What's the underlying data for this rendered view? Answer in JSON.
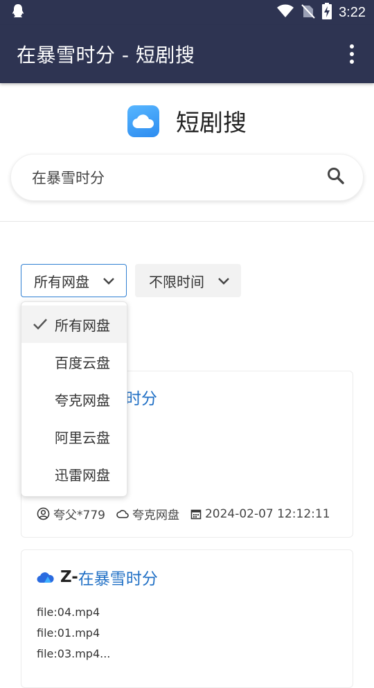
{
  "status_bar": {
    "time": "3:22"
  },
  "app_bar": {
    "title": "在暴雪时分 - 短剧搜"
  },
  "brand": {
    "name": "短剧搜"
  },
  "search": {
    "value": "在暴雪时分"
  },
  "filters": {
    "disk": {
      "label": "所有网盘"
    },
    "time": {
      "label": "不限时间"
    }
  },
  "dropdown": {
    "items": [
      {
        "label": "所有网盘",
        "selected": true
      },
      {
        "label": "百度云盘"
      },
      {
        "label": "夸克网盘"
      },
      {
        "label": "阿里云盘"
      },
      {
        "label": "迅雷网盘"
      }
    ]
  },
  "results": [
    {
      "title_visible": "时分",
      "user": "夸父*779",
      "disk": "夸克网盘",
      "date": "2024-02-07 12:12:11"
    },
    {
      "title_prefix": "Z-",
      "title_link": "在暴雪时分",
      "files": [
        "file:04.mp4",
        "file:01.mp4",
        "file:03.mp4..."
      ]
    }
  ],
  "colors": {
    "app_bar": "#2e3452",
    "link": "#1f6fc5",
    "accent": "#2f7fd2"
  }
}
